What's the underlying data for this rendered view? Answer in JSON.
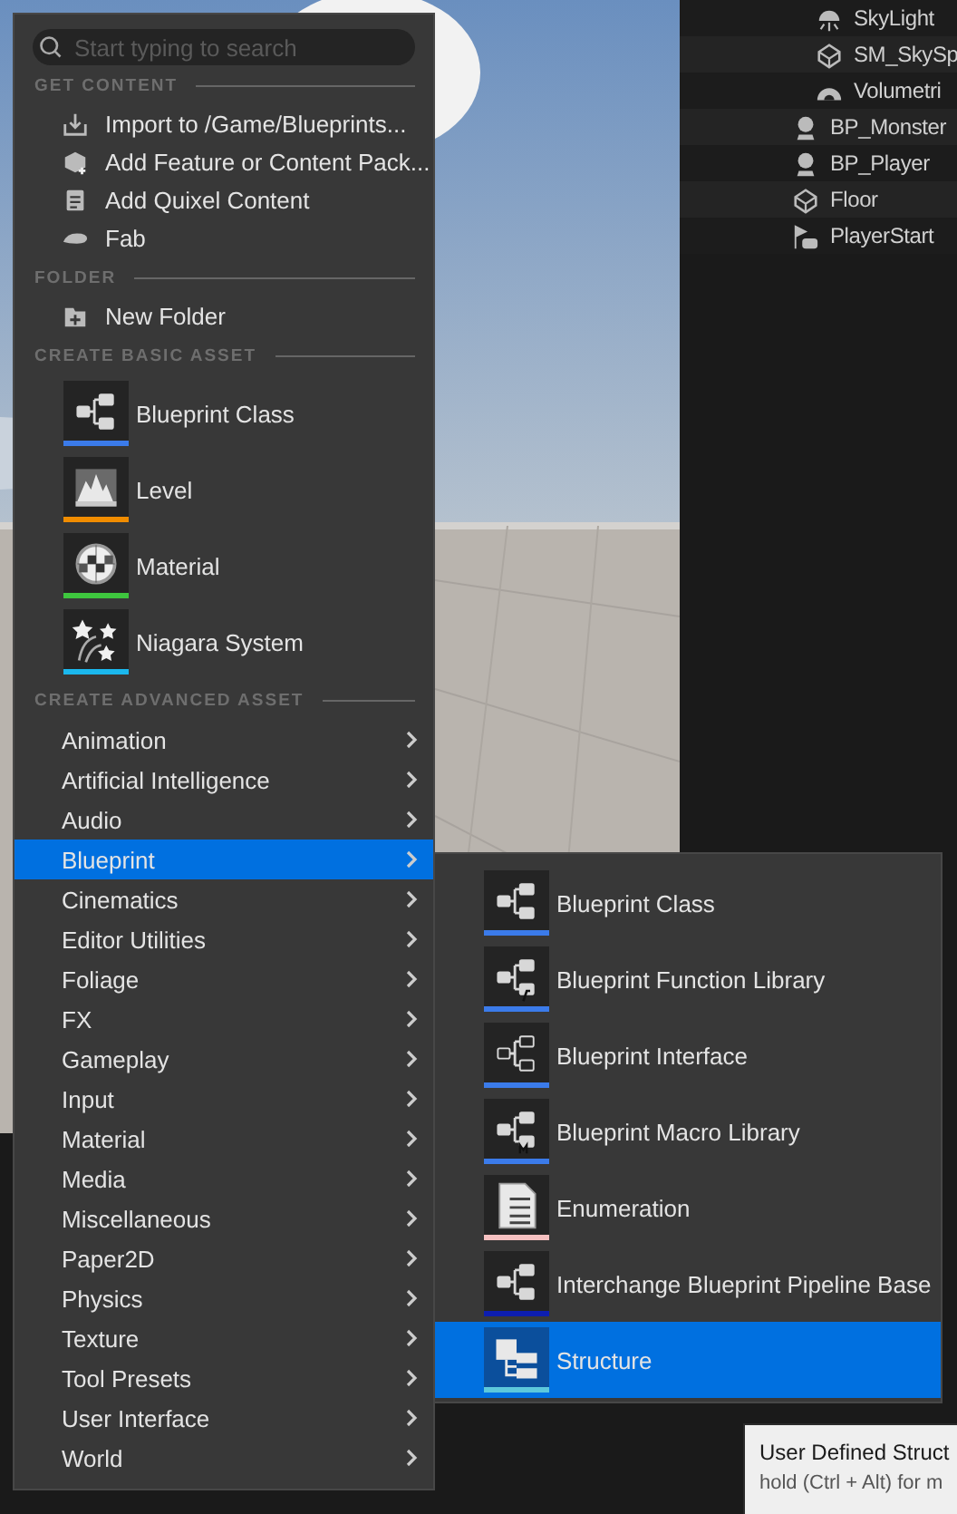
{
  "search": {
    "placeholder": "Start typing to search"
  },
  "sections": [
    {
      "title": "GET CONTENT",
      "kind": "actions",
      "items": [
        {
          "label": "Import to /Game/Blueprints..."
        },
        {
          "label": "Add Feature or Content Pack..."
        },
        {
          "label": "Add Quixel Content"
        },
        {
          "label": "Fab"
        }
      ]
    },
    {
      "title": "FOLDER",
      "kind": "actions",
      "items": [
        {
          "label": "New Folder"
        }
      ]
    },
    {
      "title": "CREATE BASIC ASSET",
      "kind": "assets",
      "items": [
        {
          "label": "Blueprint Class",
          "color": "#3b7bea"
        },
        {
          "label": "Level",
          "color": "#f08c00"
        },
        {
          "label": "Material",
          "color": "#3ec63e"
        },
        {
          "label": "Niagara System",
          "color": "#1bb8ee"
        }
      ]
    },
    {
      "title": "CREATE ADVANCED ASSET",
      "kind": "categories",
      "items": [
        {
          "label": "Animation",
          "selected": false
        },
        {
          "label": "Artificial Intelligence",
          "selected": false
        },
        {
          "label": "Audio",
          "selected": false
        },
        {
          "label": "Blueprint",
          "selected": true
        },
        {
          "label": "Cinematics",
          "selected": false
        },
        {
          "label": "Editor Utilities",
          "selected": false
        },
        {
          "label": "Foliage",
          "selected": false
        },
        {
          "label": "FX",
          "selected": false
        },
        {
          "label": "Gameplay",
          "selected": false
        },
        {
          "label": "Input",
          "selected": false
        },
        {
          "label": "Material",
          "selected": false
        },
        {
          "label": "Media",
          "selected": false
        },
        {
          "label": "Miscellaneous",
          "selected": false
        },
        {
          "label": "Paper2D",
          "selected": false
        },
        {
          "label": "Physics",
          "selected": false
        },
        {
          "label": "Texture",
          "selected": false
        },
        {
          "label": "Tool Presets",
          "selected": false
        },
        {
          "label": "User Interface",
          "selected": false
        },
        {
          "label": "World",
          "selected": false
        }
      ]
    }
  ],
  "submenu": {
    "items": [
      {
        "label": "Blueprint Class",
        "color": "#3b7bea",
        "selected": false
      },
      {
        "label": "Blueprint Function Library",
        "color": "#3b7bea",
        "selected": false
      },
      {
        "label": "Blueprint Interface",
        "color": "#3b7bea",
        "selected": false
      },
      {
        "label": "Blueprint Macro Library",
        "color": "#3b7bea",
        "selected": false
      },
      {
        "label": "Enumeration",
        "color": "#f5c0c0",
        "selected": false
      },
      {
        "label": "Interchange Blueprint Pipeline Base",
        "color": "#0d1eb0",
        "selected": false
      },
      {
        "label": "Structure",
        "color": "#5cc8dc",
        "selected": true
      }
    ]
  },
  "tooltip": {
    "title": "User Defined Struct",
    "hint": "hold (Ctrl + Alt) for m"
  },
  "outliner": {
    "items": [
      {
        "children": [
          {
            "label": "SkyLight"
          },
          {
            "label": "SM_SkySp"
          },
          {
            "label": "Volumetri"
          }
        ]
      },
      {
        "label": "BP_Monster"
      },
      {
        "label": "BP_Player"
      },
      {
        "label": "Floor"
      },
      {
        "label": "PlayerStart"
      }
    ]
  }
}
